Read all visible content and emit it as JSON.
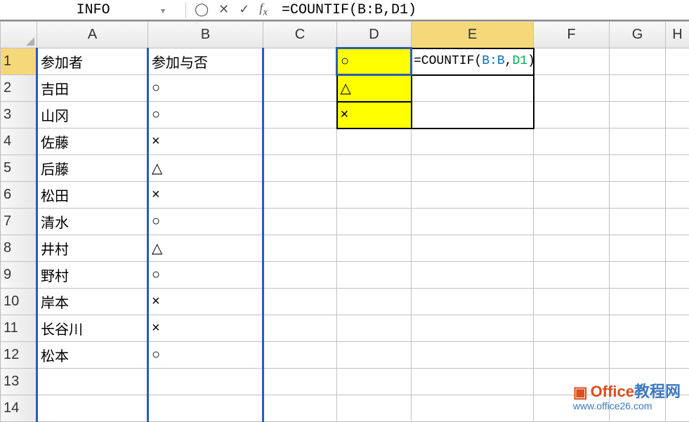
{
  "formulaBar": {
    "nameBox": "INFO",
    "formula": "=COUNTIF(B:B,D1)"
  },
  "columns": [
    "A",
    "B",
    "C",
    "D",
    "E",
    "F",
    "G",
    "H"
  ],
  "rows": [
    "1",
    "2",
    "3",
    "4",
    "5",
    "6",
    "7",
    "8",
    "9",
    "10",
    "11",
    "12",
    "13",
    "14"
  ],
  "cells": {
    "A1": "参加者",
    "B1": "参加与否",
    "D1": "○",
    "A2": "吉田",
    "B2": "○",
    "D2": "△",
    "A3": "山冈",
    "B3": "○",
    "D3": "×",
    "A4": "佐藤",
    "B4": "×",
    "A5": "后藤",
    "B5": "△",
    "A6": "松田",
    "B6": "×",
    "A7": "清水",
    "B7": "○",
    "A8": "井村",
    "B8": "△",
    "A9": "野村",
    "B9": "○",
    "A10": "岸本",
    "B10": "×",
    "A11": "长谷川",
    "B11": "×",
    "A12": "松本",
    "B12": "○"
  },
  "editingCell": {
    "ref": "E1",
    "parts": {
      "p1": "=COUNTIF",
      "p2": "(",
      "p3": "B:B",
      "p4": ",",
      "p5": "D1",
      "p6": ")"
    }
  },
  "watermark": {
    "brand1": "Office",
    "brand2": "教程网",
    "url": "www.office26.com"
  }
}
